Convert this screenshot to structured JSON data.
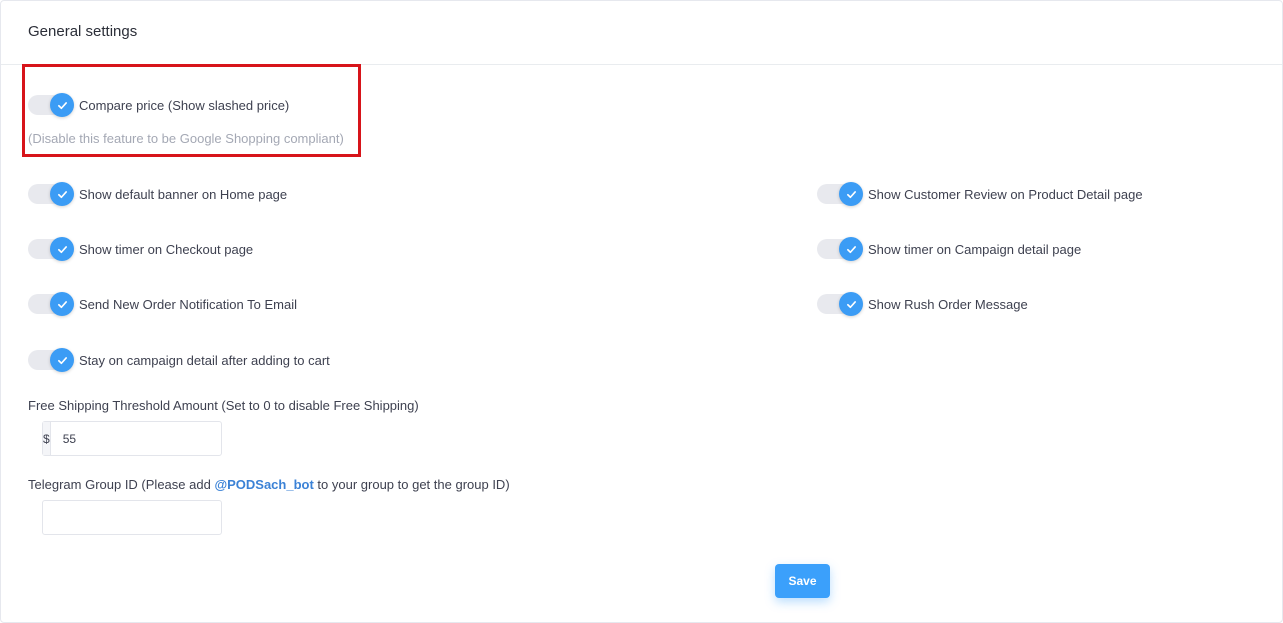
{
  "header": {
    "title": "General settings"
  },
  "compare_price": {
    "label": "Compare price (Show slashed price)",
    "hint": "(Disable this feature to be Google Shopping compliant)",
    "enabled": true
  },
  "toggles": {
    "show_default_banner": {
      "label": "Show default banner on Home page",
      "enabled": true
    },
    "show_timer_checkout": {
      "label": "Show timer on Checkout page",
      "enabled": true
    },
    "send_order_notification": {
      "label": "Send New Order Notification To Email",
      "enabled": true
    },
    "stay_on_campaign": {
      "label": "Stay on campaign detail after adding to cart",
      "enabled": true
    },
    "show_customer_review": {
      "label": "Show Customer Review on Product Detail page",
      "enabled": true
    },
    "show_timer_campaign": {
      "label": "Show timer on Campaign detail page",
      "enabled": true
    },
    "show_rush_order": {
      "label": "Show Rush Order Message",
      "enabled": true
    }
  },
  "free_shipping": {
    "label": "Free Shipping Threshold Amount (Set to 0 to disable Free Shipping)",
    "currency_symbol": "$",
    "value": "55"
  },
  "telegram": {
    "label_before": "Telegram Group ID (Please add ",
    "bot_name": "@PODSach_bot",
    "label_after": " to your group to get the group ID)",
    "value": ""
  },
  "actions": {
    "save_label": "Save"
  },
  "colors": {
    "accent": "#3b9cf5",
    "highlight_border": "#d7141a",
    "link": "#3b82d6"
  },
  "icons": {
    "toggle_check": "check-icon"
  }
}
